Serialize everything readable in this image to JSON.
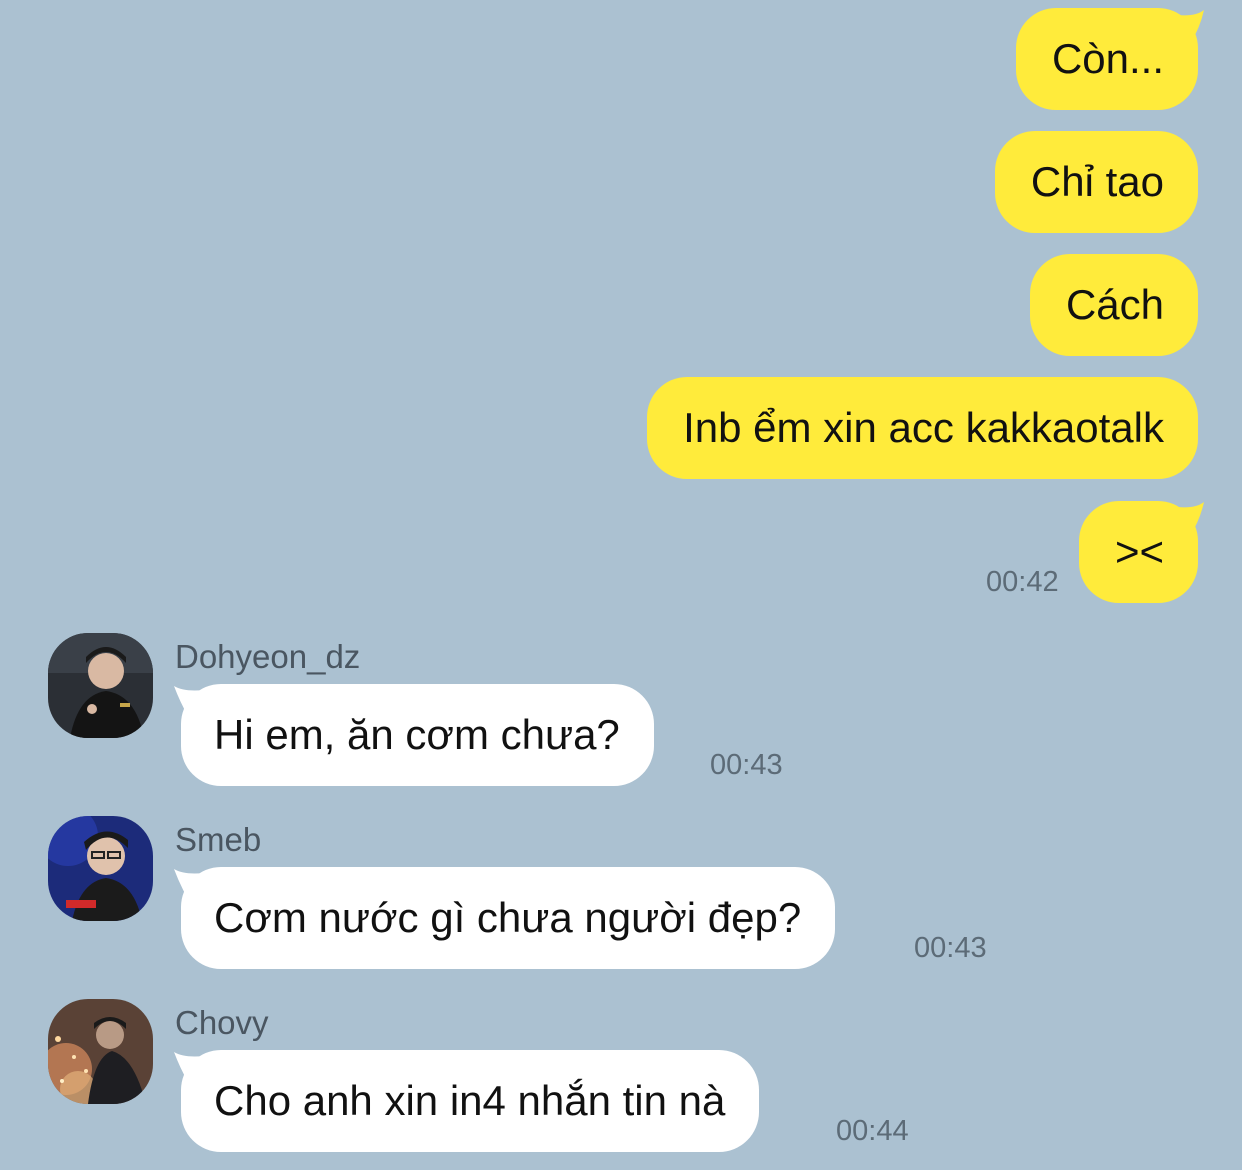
{
  "outgoing": [
    {
      "text": "Còn..."
    },
    {
      "text": "Chỉ tao"
    },
    {
      "text": "Cách"
    },
    {
      "text": "Inb ểm xin acc kakkaotalk"
    },
    {
      "text": "><",
      "time": "00:42"
    }
  ],
  "incoming": [
    {
      "sender": "Dohyeon_dz",
      "text": "Hi em, ăn cơm chưa?",
      "time": "00:43",
      "avatar_icon": "profile-photo-dohyeon-icon"
    },
    {
      "sender": "Smeb",
      "text": "Cơm nước gì chưa người đẹp?",
      "time": "00:43",
      "avatar_icon": "profile-photo-smeb-icon"
    },
    {
      "sender": "Chovy",
      "text": "Cho anh xin in4 nhắn tin nà",
      "time": "00:44",
      "avatar_icon": "profile-photo-chovy-icon"
    }
  ],
  "colors": {
    "background": "#abc1d1",
    "outgoing_bubble": "#ffeb3b",
    "incoming_bubble": "#ffffff",
    "timestamp": "#5c6b77",
    "sender_name": "#4a5661"
  }
}
